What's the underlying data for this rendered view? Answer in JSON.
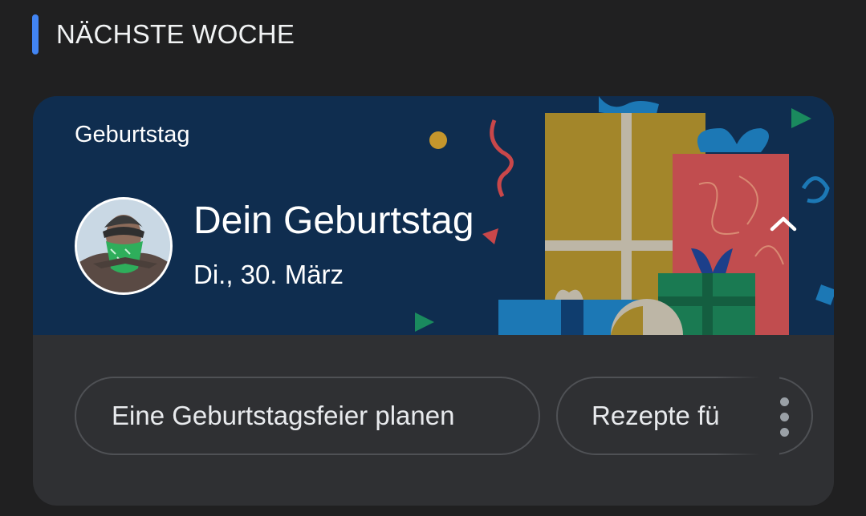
{
  "section": {
    "title": "NÄCHSTE WOCHE"
  },
  "card": {
    "category": "Geburtstag",
    "title": "Dein Geburtstag",
    "date": "Di., 30. März",
    "avatar_icon": "bandana-person-avatar",
    "collapse_icon": "chevron-up-icon",
    "more_icon": "more-vertical-icon",
    "actions": [
      {
        "label": "Eine Geburtstagsfeier planen"
      },
      {
        "label": "Rezepte fü"
      }
    ]
  },
  "colors": {
    "page_bg": "#202021",
    "banner_bg": "#0f2d4f",
    "card_bg": "#2f3033",
    "accent": "#4285f4"
  }
}
